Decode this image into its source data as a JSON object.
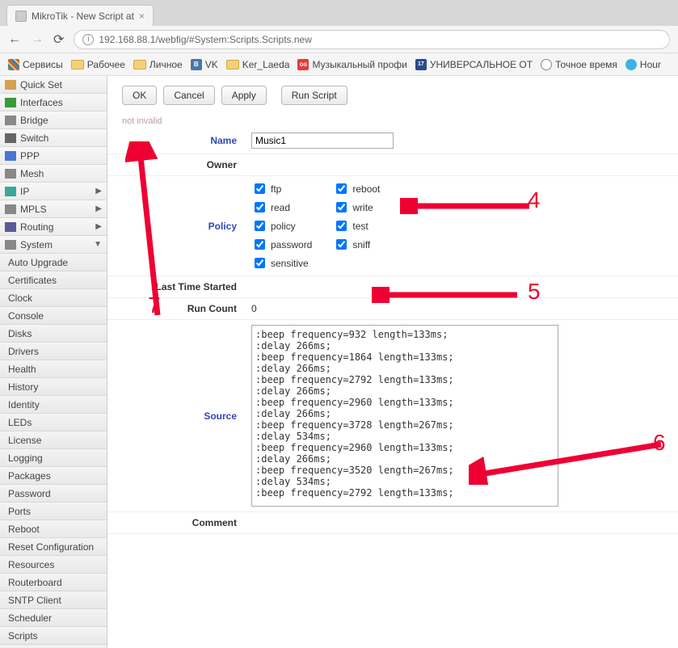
{
  "browser": {
    "tab_title": "MikroTik - New Script at",
    "url": "192.168.88.1/webfig/#System:Scripts.Scripts.new",
    "bookmarks": [
      {
        "label": "Сервисы",
        "icon": "apps"
      },
      {
        "label": "Рабочее",
        "icon": "folder"
      },
      {
        "label": "Личное",
        "icon": "folder"
      },
      {
        "label": "VK",
        "icon": "vk"
      },
      {
        "label": "Ker_Laeda",
        "icon": "folder"
      },
      {
        "label": "Музыкальный профи",
        "icon": "os"
      },
      {
        "label": "УНИВЕРСАЛЬНОЕ ОТ",
        "icon": "17"
      },
      {
        "label": "Точное время",
        "icon": "time"
      },
      {
        "label": "Hour",
        "icon": "hr"
      }
    ]
  },
  "sidebar": {
    "main": [
      {
        "label": "Quick Set",
        "icon": "#d8a050"
      },
      {
        "label": "Interfaces",
        "icon": "#3a9a3a"
      },
      {
        "label": "Bridge",
        "icon": "#888"
      },
      {
        "label": "Switch",
        "icon": "#666"
      },
      {
        "label": "PPP",
        "icon": "#4a76d8"
      },
      {
        "label": "Mesh",
        "icon": "#888"
      },
      {
        "label": "IP",
        "icon": "#3aa89a",
        "arrow": true
      },
      {
        "label": "MPLS",
        "icon": "#888",
        "arrow": true
      },
      {
        "label": "Routing",
        "icon": "#5a5a98",
        "arrow": true
      },
      {
        "label": "System",
        "icon": "#888",
        "arrow": "down"
      }
    ],
    "sub": [
      "Auto Upgrade",
      "Certificates",
      "Clock",
      "Console",
      "Disks",
      "Drivers",
      "Health",
      "History",
      "Identity",
      "LEDs",
      "License",
      "Logging",
      "Packages",
      "Password",
      "Ports",
      "Reboot",
      "Reset Configuration",
      "Resources",
      "Routerboard",
      "SNTP Client",
      "Scheduler",
      "Scripts"
    ]
  },
  "buttons": {
    "ok": "OK",
    "cancel": "Cancel",
    "apply": "Apply",
    "run": "Run Script"
  },
  "hint": "not invalid",
  "labels": {
    "name": "Name",
    "owner": "Owner",
    "policy": "Policy",
    "last_time": "Last Time Started",
    "run_count": "Run Count",
    "source": "Source",
    "comment": "Comment"
  },
  "form": {
    "name_value": "Music1",
    "run_count_value": "0",
    "policies_col1": [
      {
        "key": "ftp",
        "checked": true
      },
      {
        "key": "read",
        "checked": true
      },
      {
        "key": "policy",
        "checked": true
      },
      {
        "key": "password",
        "checked": true
      },
      {
        "key": "sensitive",
        "checked": true
      }
    ],
    "policies_col2": [
      {
        "key": "reboot",
        "checked": true
      },
      {
        "key": "write",
        "checked": true
      },
      {
        "key": "test",
        "checked": true
      },
      {
        "key": "sniff",
        "checked": true
      }
    ],
    "source_value": ":beep frequency=932 length=133ms;\n:delay 266ms;\n:beep frequency=1864 length=133ms;\n:delay 266ms;\n:beep frequency=2792 length=133ms;\n:delay 266ms;\n:beep frequency=2960 length=133ms;\n:delay 266ms;\n:beep frequency=3728 length=267ms;\n:delay 534ms;\n:beep frequency=2960 length=133ms;\n:delay 266ms;\n:beep frequency=3520 length=267ms;\n:delay 534ms;\n:beep frequency=2792 length=133ms;"
  },
  "annotations": {
    "n4": "4",
    "n5": "5",
    "n6": "6",
    "n7": "7"
  }
}
